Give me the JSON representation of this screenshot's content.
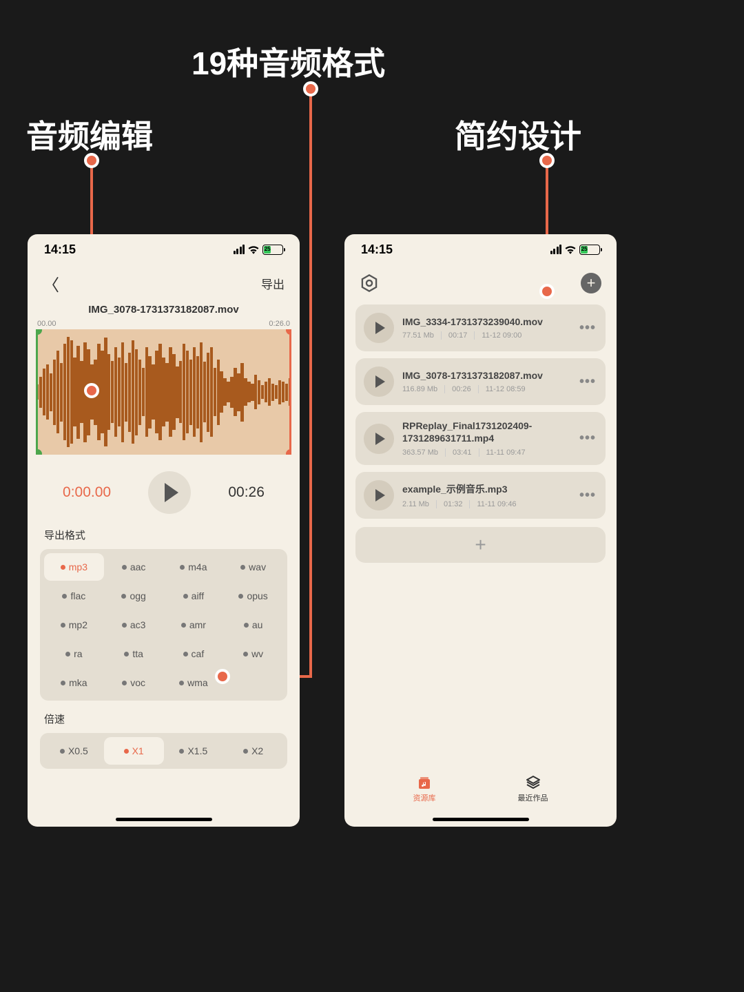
{
  "callouts": {
    "top": "19种音频格式",
    "left": "音频编辑",
    "right": "简约设计"
  },
  "status": {
    "time": "14:15",
    "battery": "25"
  },
  "editor": {
    "export_label": "导出",
    "filename": "IMG_3078-1731373182087.mov",
    "wf_start": "00.00",
    "wf_end": "0:26.0",
    "time_current": "0:00.00",
    "time_total": "00:26",
    "format_label": "导出格式",
    "formats": [
      "mp3",
      "aac",
      "m4a",
      "wav",
      "flac",
      "ogg",
      "aiff",
      "opus",
      "mp2",
      "ac3",
      "amr",
      "au",
      "ra",
      "tta",
      "caf",
      "wv",
      "mka",
      "voc",
      "wma"
    ],
    "active_format": "mp3",
    "speed_label": "倍速",
    "speeds": [
      "X0.5",
      "X1",
      "X1.5",
      "X2"
    ],
    "active_speed": "X1"
  },
  "library": {
    "files": [
      {
        "title": "IMG_3334-1731373239040.mov",
        "size": "77.51 Mb",
        "dur": "00:17",
        "date": "11-12 09:00",
        "wrap": false
      },
      {
        "title": "IMG_3078-1731373182087.mov",
        "size": "116.89 Mb",
        "dur": "00:26",
        "date": "11-12 08:59",
        "wrap": false
      },
      {
        "title": "RPReplay_Final1731202409-1731289631711.mp4",
        "size": "363.57 Mb",
        "dur": "03:41",
        "date": "11-11 09:47",
        "wrap": true
      },
      {
        "title": "example_示例音乐.mp3",
        "size": "2.11 Mb",
        "dur": "01:32",
        "date": "11-11 09:46",
        "wrap": false
      }
    ],
    "tab_library": "资源库",
    "tab_recent": "最近作品"
  }
}
